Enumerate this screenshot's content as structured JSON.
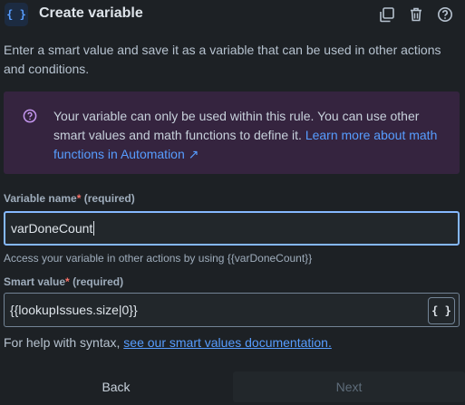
{
  "header": {
    "icon_glyph": "{ }",
    "title": "Create variable",
    "actions": [
      "duplicate-icon",
      "trash-icon",
      "help-icon"
    ]
  },
  "description": "Enter a smart value and save it as a variable that can be used in other actions and conditions.",
  "info_panel": {
    "icon": "question-circle-icon",
    "text": "Your variable can only be used within this rule. You can use other smart values and math functions to define it.",
    "link_text": "Learn more about math functions in Automation ↗"
  },
  "variable_name": {
    "label": "Variable name",
    "required_mark": "*",
    "required_text": "(required)",
    "value": "varDoneCount",
    "helper": "Access your variable in other actions by using {{varDoneCount}}"
  },
  "smart_value": {
    "label": "Smart value",
    "required_mark": "*",
    "required_text": "(required)",
    "value": "{{lookupIssues.size|0}}",
    "button_glyph": "{ }"
  },
  "help": {
    "prefix": "For help with syntax,",
    "link_text": "see our smart values documentation."
  },
  "footer": {
    "back_label": "Back",
    "next_label": "Next"
  },
  "colors": {
    "background": "#1d2125",
    "accent": "#579dff",
    "info_bg": "#35243f",
    "required": "#f87168",
    "focus_border": "#85b8ff"
  }
}
